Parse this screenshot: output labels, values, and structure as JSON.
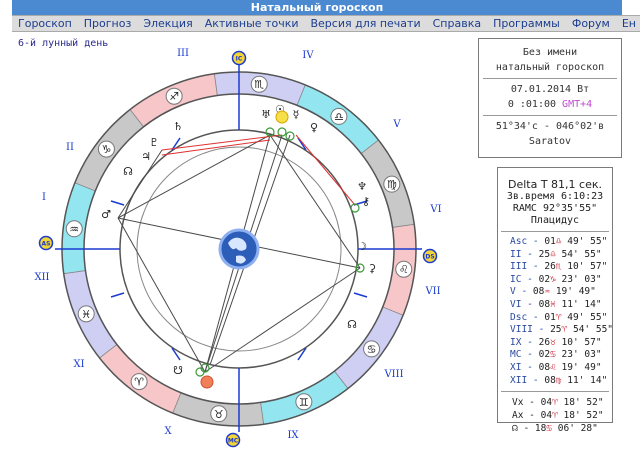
{
  "title": "Натальный гороскоп",
  "menu": [
    "Гороскоп",
    "Прогноз",
    "Элекция",
    "Активные точки",
    "Версия для печати",
    "Справка",
    "Программы",
    "Форум",
    "Ен"
  ],
  "moon_day": "6-й лунный день",
  "house_labels": [
    "I",
    "II",
    "III",
    "IV",
    "V",
    "VI",
    "VII",
    "VIII",
    "IX",
    "X",
    "XI",
    "XII"
  ],
  "axis_badges": [
    "IC",
    "DS",
    "MC",
    "AS"
  ],
  "info": {
    "name": "Без имени",
    "type": "натальный гороскоп",
    "date": "07.01.2014 Вт",
    "time": "0 :01:00",
    "gmt": "GMT+4",
    "coords": "51°34'с - 046°02'в",
    "city": "Saratov"
  },
  "houses_panel": {
    "delta_t": "Delta T   81,1 сек.",
    "sidereal": "Зв.время 6:10:23",
    "ramc": "RAMC 92°35'55\"",
    "system": "Плацидус"
  },
  "cusps": [
    {
      "name": "Asc",
      "deg": "01",
      "sign": "♎",
      "min": "49' 55\""
    },
    {
      "name": "II",
      "deg": "25",
      "sign": "♎",
      "min": "54' 55\""
    },
    {
      "name": "III",
      "deg": "26",
      "sign": "♏",
      "min": "10' 57\""
    },
    {
      "name": "IC",
      "deg": "02",
      "sign": "♑",
      "min": "23' 03\""
    },
    {
      "name": "V",
      "deg": "08",
      "sign": "♒",
      "min": "19' 49\""
    },
    {
      "name": "VI",
      "deg": "08",
      "sign": "♓",
      "min": "11' 14\""
    },
    {
      "name": "Dsc",
      "deg": "01",
      "sign": "♈",
      "min": "49' 55\""
    },
    {
      "name": "VIII",
      "deg": "25",
      "sign": "♈",
      "min": "54' 55\""
    },
    {
      "name": "IX",
      "deg": "26",
      "sign": "♉",
      "min": "10' 57\""
    },
    {
      "name": "MC",
      "deg": "02",
      "sign": "♋",
      "min": "23' 03\""
    },
    {
      "name": "XI",
      "deg": "08",
      "sign": "♌",
      "min": "19' 49\""
    },
    {
      "name": "XII",
      "deg": "08",
      "sign": "♍",
      "min": "11' 14\""
    }
  ],
  "points": [
    {
      "name": "Vx",
      "deg": "04",
      "sign": "♈",
      "min": "18' 52\""
    },
    {
      "name": "Ax",
      "deg": "04",
      "sign": "♈",
      "min": "18' 52\""
    },
    {
      "name": "☊",
      "deg": "18",
      "sign": "♋",
      "min": "06' 28\""
    }
  ],
  "zodiac_glyphs": [
    "♐",
    "♏",
    "♎",
    "♍",
    "♌",
    "♋",
    "♊",
    "♉",
    "♈",
    "♓",
    "♒",
    "♑"
  ],
  "planet_glyphs": [
    "♄",
    "♅",
    "♂",
    "♆",
    "♃",
    "☿",
    "♀",
    "☽",
    "⚷",
    "♇",
    "☉",
    "⚳"
  ],
  "colors": {
    "title_bg": "#4b89d1",
    "fire": "#f6c6c8",
    "air": "#93e6f0",
    "earth": "#c8c8c8",
    "water": "#cfcff4",
    "house_line": "#1a3ad0",
    "aspect_red": "#e03030"
  }
}
